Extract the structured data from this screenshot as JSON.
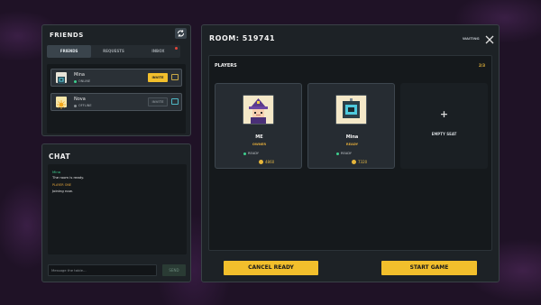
{
  "friends": {
    "title": "FRIENDS",
    "refresh_icon": "refresh-icon",
    "tabs": [
      {
        "label": "FRIENDS",
        "active": true
      },
      {
        "label": "REQUESTS",
        "active": false
      },
      {
        "label": "INBOX",
        "active": false,
        "notification": true
      }
    ],
    "list": [
      {
        "name": "Mina",
        "status": "ONLINE",
        "status_color": "#3ecf8e",
        "invite_label": "INVITE",
        "invite_enabled": true
      },
      {
        "name": "Nova",
        "status": "OFFLINE",
        "status_color": "#8a9095",
        "invite_label": "INVITE",
        "invite_enabled": false
      }
    ]
  },
  "chat": {
    "title": "CHAT",
    "messages": [
      {
        "sender": "Mina",
        "sender_color": "#3ecf8e",
        "text": "The room is ready."
      },
      {
        "sender": "PLAYER ONE",
        "sender_color": "#e2a33a",
        "text": "Joining now."
      }
    ],
    "input_placeholder": "Message the table…",
    "send_label": "SEND"
  },
  "room": {
    "title": "ROOM: 519741",
    "status": "WAITING",
    "players_label": "PLAYERS",
    "players_count": "2/3",
    "seats": [
      {
        "name": "ME",
        "role": "OWNER",
        "ready": "READY",
        "coins": "4860",
        "avatar": "wizard-avatar"
      },
      {
        "name": "Mina",
        "role": "READY",
        "ready": "READY",
        "coins": "7320",
        "avatar": "robot-avatar"
      },
      {
        "empty_label": "EMPTY SEAT"
      }
    ],
    "cancel_label": "CANCEL READY",
    "start_label": "START GAME"
  },
  "colors": {
    "accent": "#f2bf2c",
    "ready": "#3ecf8e"
  }
}
